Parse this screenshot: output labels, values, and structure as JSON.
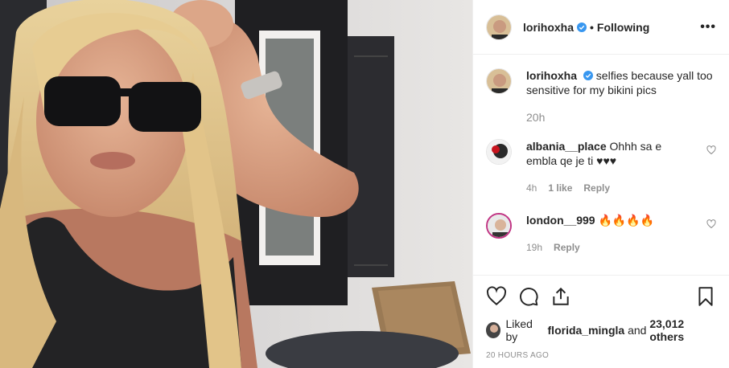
{
  "post": {
    "author": "lorihoxha",
    "follow_label": "Following",
    "separator": "•",
    "more_label": "•••"
  },
  "caption": {
    "user": "lorihoxha",
    "text": "selfies because yall too sensitive for my bikini pics",
    "time": "20h"
  },
  "comments": [
    {
      "user": "albania__place",
      "text": "Ohhh sa e embla qe je ti ♥♥♥",
      "time": "4h",
      "likes": "1 like",
      "reply": "Reply"
    },
    {
      "user": "london__999",
      "text": "🔥🔥🔥🔥",
      "time": "19h",
      "reply": "Reply"
    }
  ],
  "likes": {
    "prefix": "Liked by",
    "user": "florida_mingla",
    "middle": "and",
    "count": "23,012 others"
  },
  "timestamp": "20 HOURS AGO",
  "icons": [
    "heart-icon",
    "comment-icon",
    "share-icon",
    "bookmark-icon",
    "verified-badge-icon"
  ],
  "colors": {
    "verified": "#3897f0",
    "muted": "#8e8e8e",
    "text": "#262626"
  }
}
